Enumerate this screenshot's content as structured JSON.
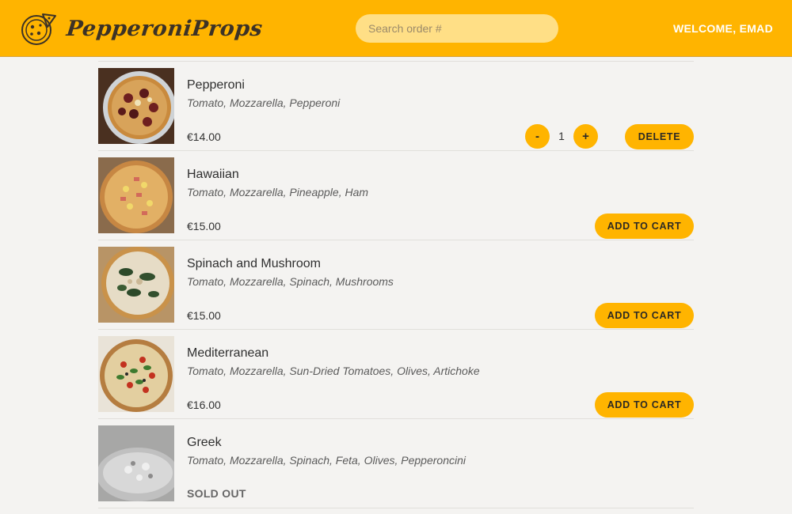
{
  "header": {
    "brand": "PepperoniProps",
    "search_placeholder": "Search order #",
    "welcome": "WELCOME, EMAD"
  },
  "colors": {
    "accent": "#ffb400",
    "search_bg": "#ffdf86",
    "page_bg": "#f4f3f1"
  },
  "menu": {
    "items": [
      {
        "name": "Pepperoni",
        "ingredients": "Tomato, Mozzarella, Pepperoni",
        "price": "€14.00",
        "quantity": "1",
        "action": "DELETE",
        "decrement": "-",
        "increment": "+"
      },
      {
        "name": "Hawaiian",
        "ingredients": "Tomato, Mozzarella, Pineapple, Ham",
        "price": "€15.00",
        "action": "ADD TO CART"
      },
      {
        "name": "Spinach and Mushroom",
        "ingredients": "Tomato, Mozzarella, Spinach, Mushrooms",
        "price": "€15.00",
        "action": "ADD TO CART"
      },
      {
        "name": "Mediterranean",
        "ingredients": "Tomato, Mozzarella, Sun-Dried Tomatoes, Olives, Artichoke",
        "price": "€16.00",
        "action": "ADD TO CART"
      },
      {
        "name": "Greek",
        "ingredients": "Tomato, Mozzarella, Spinach, Feta, Olives, Pepperoncini",
        "status": "SOLD OUT"
      }
    ]
  }
}
